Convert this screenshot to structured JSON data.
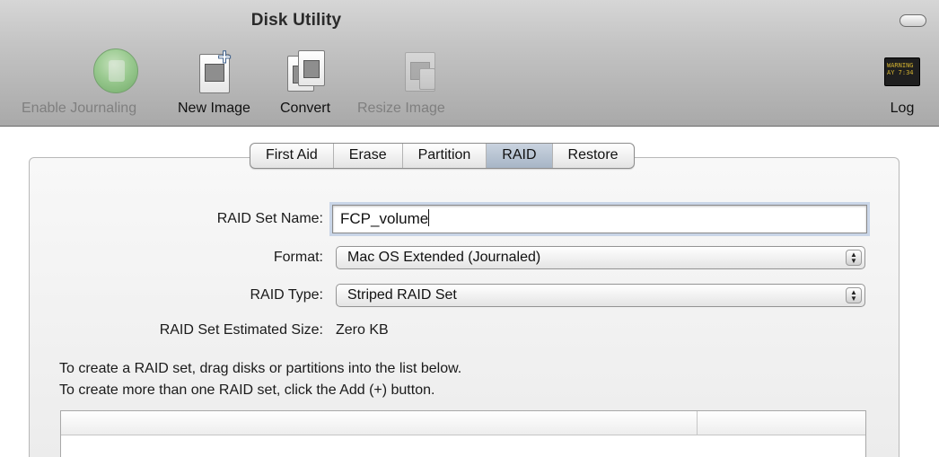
{
  "window": {
    "title": "Disk Utility"
  },
  "toolbar": {
    "items": [
      {
        "label": "Enable Journaling",
        "icon": "enable-journaling-icon",
        "enabled": false
      },
      {
        "label": "New Image",
        "icon": "new-image-icon",
        "enabled": true
      },
      {
        "label": "Convert",
        "icon": "convert-icon",
        "enabled": true
      },
      {
        "label": "Resize Image",
        "icon": "resize-image-icon",
        "enabled": false
      },
      {
        "label": "Log",
        "icon": "log-icon",
        "enabled": true
      }
    ],
    "log_icon_text": "WARNING AY 7:34"
  },
  "tabs": [
    {
      "label": "First Aid",
      "active": false
    },
    {
      "label": "Erase",
      "active": false
    },
    {
      "label": "Partition",
      "active": false
    },
    {
      "label": "RAID",
      "active": true
    },
    {
      "label": "Restore",
      "active": false
    }
  ],
  "raid": {
    "set_name_label": "RAID Set Name:",
    "set_name_value": "FCP_volume",
    "format_label": "Format:",
    "format_value": "Mac OS Extended (Journaled)",
    "type_label": "RAID Type:",
    "type_value": "Striped RAID Set",
    "size_label": "RAID Set Estimated Size:",
    "size_value": "Zero KB",
    "help_line_1": "To create a RAID set, drag disks or partitions into the list below.",
    "help_line_2": "To create more than one RAID set, click the Add (+) button."
  },
  "colors": {
    "toolbar_top": "#d6d6d6",
    "toolbar_bottom": "#a9a9a9",
    "active_tab": "#b8c4d3",
    "focus_ring": "#789bcd",
    "journaling_green": "#8fcf82"
  }
}
